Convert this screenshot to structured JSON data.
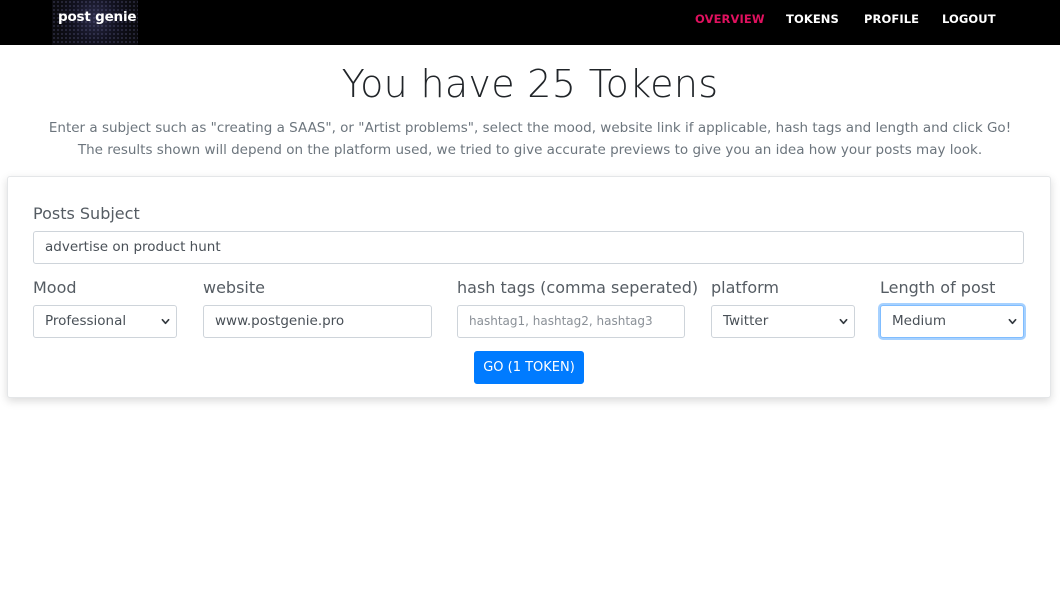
{
  "nav": {
    "logo_text": "post genie",
    "links": [
      {
        "label": "OVERVIEW",
        "active": true
      },
      {
        "label": "TOKENS",
        "active": false
      },
      {
        "label": "PROFILE",
        "active": false
      },
      {
        "label": "LOGOUT",
        "active": false
      }
    ]
  },
  "header": {
    "title": "You have 25 Tokens",
    "line1": "Enter a subject such as \"creating a SAAS\", or \"Artist problems\", select the mood, website link if applicable, hash tags and length and click Go!",
    "line2": "The results shown will depend on the platform used, we tried to give accurate previews to give you an idea how your posts may look."
  },
  "form": {
    "subject": {
      "label": "Posts Subject",
      "value": "advertise on product hunt"
    },
    "mood": {
      "label": "Mood",
      "value": "Professional"
    },
    "website": {
      "label": "website",
      "value": "www.postgenie.pro"
    },
    "hashtags": {
      "label": "hash tags (comma seperated)",
      "value": "",
      "placeholder": "hashtag1, hashtag2, hashtag3"
    },
    "platform": {
      "label": "platform",
      "value": "Twitter"
    },
    "length": {
      "label": "Length of post",
      "value": "Medium"
    },
    "go_label": "GO (1 TOKEN)"
  },
  "colors": {
    "navbar_bg": "#000000",
    "nav_active": "#e0115f",
    "primary_button": "#007bff",
    "focus_ring": "#80bdff"
  },
  "icons": {
    "select_arrow": "chevron-down-icon"
  }
}
